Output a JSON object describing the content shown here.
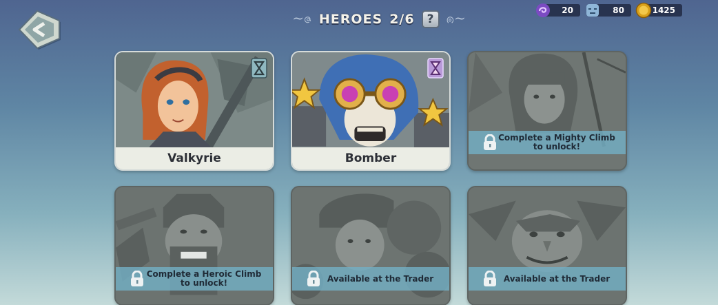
{
  "header": {
    "title": "HEROES",
    "count": "2/6",
    "help_label": "?"
  },
  "currencies": [
    {
      "icon": "purple-swirl-icon",
      "value": "20"
    },
    {
      "icon": "blue-face-icon",
      "value": "80"
    },
    {
      "icon": "gold-coin-icon",
      "value": "1425"
    }
  ],
  "heroes": [
    {
      "name": "Valkyrie",
      "unlocked": true,
      "badge": "hourglass-badge-icon"
    },
    {
      "name": "Bomber",
      "unlocked": true,
      "badge": "purple-hourglass-badge-icon"
    },
    {
      "name": "",
      "unlocked": false,
      "lock_text": "Complete a Mighty Climb to unlock!"
    },
    {
      "name": "",
      "unlocked": false,
      "lock_text": "Complete a Heroic Climb to unlock!"
    },
    {
      "name": "",
      "unlocked": false,
      "lock_text": "Available at the Trader"
    },
    {
      "name": "",
      "unlocked": false,
      "lock_text": "Available at the Trader"
    }
  ],
  "colors": {
    "panel_bg": "#28334f",
    "card_plate": "#ebede5",
    "lock_banner": "#73afc3",
    "locked_stone": "#6e7572"
  }
}
